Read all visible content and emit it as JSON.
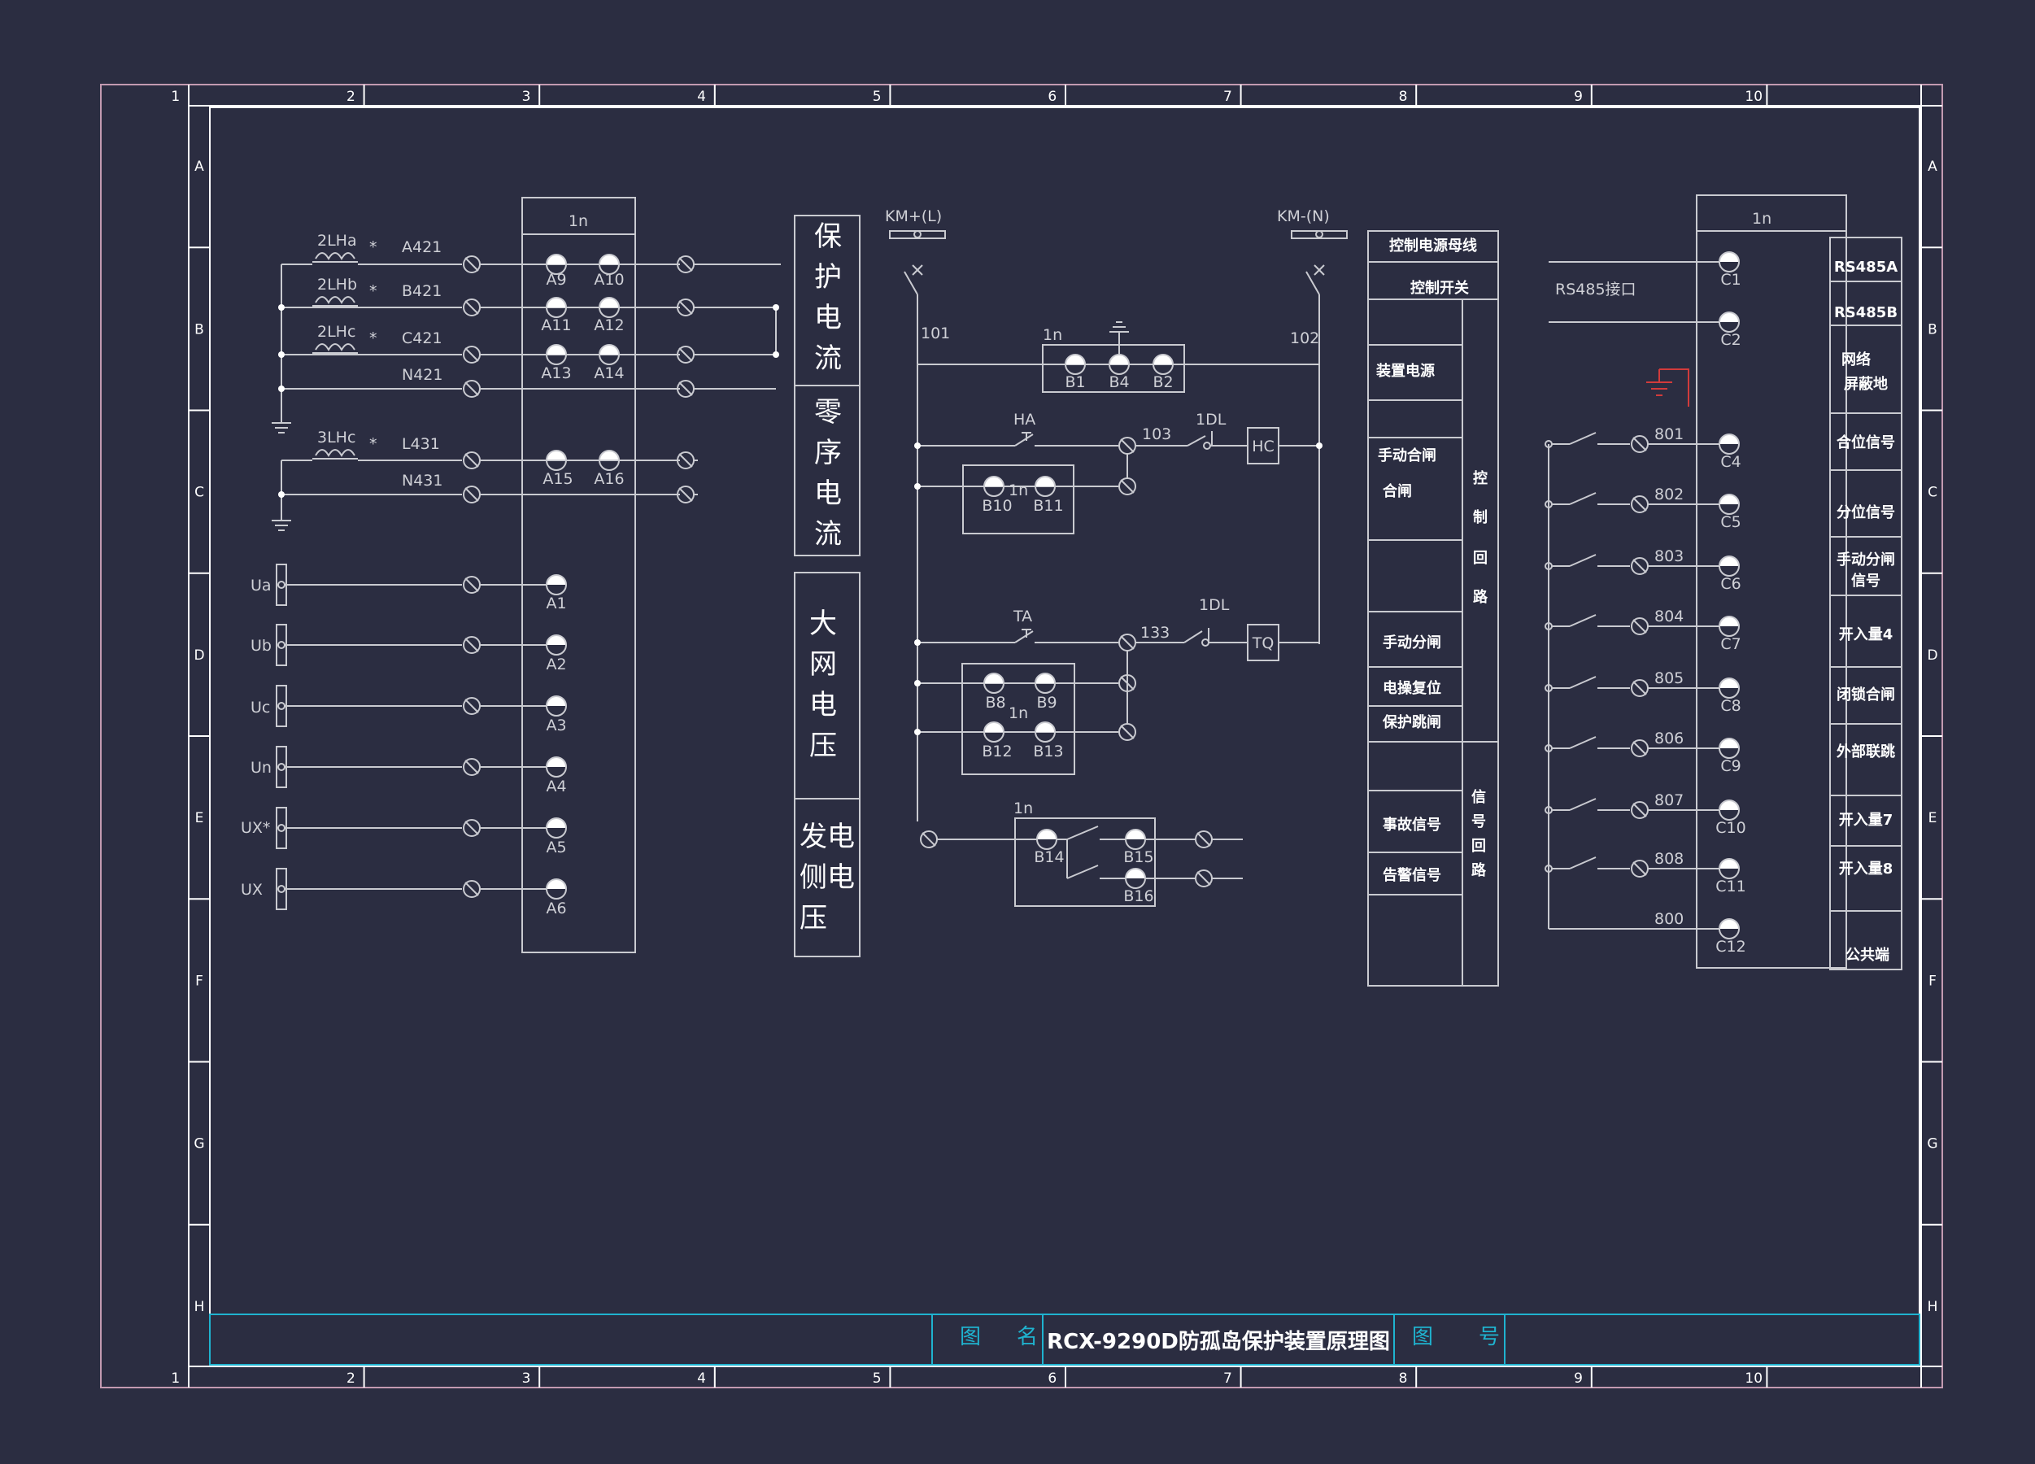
{
  "columns": [
    "1",
    "2",
    "3",
    "4",
    "5",
    "6",
    "7",
    "8",
    "9",
    "10"
  ],
  "rows": [
    "A",
    "B",
    "C",
    "D",
    "E",
    "F",
    "G",
    "H"
  ],
  "left_section": {
    "box_title": "1n",
    "ct": [
      {
        "coil": "2LHa",
        "star": "*",
        "wire": "A421",
        "t1": "A9",
        "t2": "A10"
      },
      {
        "coil": "2LHb",
        "star": "*",
        "wire": "B421",
        "t1": "A11",
        "t2": "A12"
      },
      {
        "coil": "2LHc",
        "star": "*",
        "wire": "C421",
        "t1": "A13",
        "t2": "A14"
      },
      {
        "coil": "",
        "star": "",
        "wire": "N421",
        "t1": "",
        "t2": ""
      }
    ],
    "zero_ct": [
      {
        "coil": "3LHc",
        "star": "*",
        "wire": "L431",
        "t1": "A15",
        "t2": "A16"
      },
      {
        "coil": "",
        "star": "",
        "wire": "N431",
        "t1": "",
        "t2": ""
      }
    ],
    "voltages": [
      {
        "label": "Ua",
        "terminal": "A1"
      },
      {
        "label": "Ub",
        "terminal": "A2"
      },
      {
        "label": "Uc",
        "terminal": "A3"
      },
      {
        "label": "Un",
        "terminal": "A4"
      },
      {
        "label": "UX*",
        "terminal": "A5"
      },
      {
        "label": "UX",
        "terminal": "A6"
      }
    ]
  },
  "mid_labels": {
    "box1": "保护电流",
    "box2": "零序电流",
    "box3": "大网电压",
    "box4_col1": "发侧压",
    "box4_col2": "电电"
  },
  "control": {
    "km_pos": "KM+(L)",
    "km_neg": "KM-(N)",
    "w101": "101",
    "w102": "102",
    "w103": "103",
    "w133": "133",
    "ha": "HA",
    "ta": "TA",
    "dl1": "1DL",
    "dl2": "1DL",
    "hc": "HC",
    "tq": "TQ",
    "box_1n_a": "1n",
    "box_1n_b": "1n",
    "box_1n_c": "1n",
    "box_1n_d": "1n",
    "b1": "B1",
    "b4": "B4",
    "b2": "B2",
    "b10": "B10",
    "b11": "B11",
    "b8": "B8",
    "b9": "B9",
    "b12": "B12",
    "b13": "B13",
    "b14": "B14",
    "b15": "B15",
    "b16": "B16"
  },
  "legend_table": {
    "row1": "控制电源母线",
    "row2": "控制开关",
    "items": [
      "装置电源",
      "手动合闸",
      "合闸",
      "手动分闸",
      "电操复位",
      "保护跳闸",
      "事故信号",
      "告警信号"
    ],
    "col_ctrl": [
      "控",
      "制",
      "回",
      "路"
    ],
    "col_sig": [
      "信",
      "号",
      "回",
      "路"
    ]
  },
  "right_section": {
    "box_title": "1n",
    "rs485": "RS485接口",
    "c_terms": [
      "C1",
      "C2",
      "C4",
      "C5",
      "C6",
      "C7",
      "C8",
      "C9",
      "C10",
      "C11",
      "C12"
    ],
    "wires": [
      "801",
      "802",
      "803",
      "804",
      "805",
      "806",
      "807",
      "808",
      "800"
    ]
  },
  "right_labels": [
    "RS485A",
    "RS485B",
    "网络",
    "屏蔽地",
    "合位信号",
    "分位信号",
    "手动分闸",
    "信号",
    "开入量4",
    "闭锁合闸",
    "外部联跳",
    "开入量7",
    "开入量8",
    "公共端"
  ],
  "title_block": {
    "name_label_1": "图",
    "name_label_2": "名",
    "title": "RCX-9290D防孤岛保护装置原理图",
    "num_label_1": "图",
    "num_label_2": "号"
  },
  "colors": {
    "background": "#2b2d41",
    "line": "#c9cad0",
    "frame": "#ffffff",
    "outer_frame": "#c39ab1",
    "title_block": "#1fb3cf",
    "ground_accent": "#d23b3b"
  }
}
